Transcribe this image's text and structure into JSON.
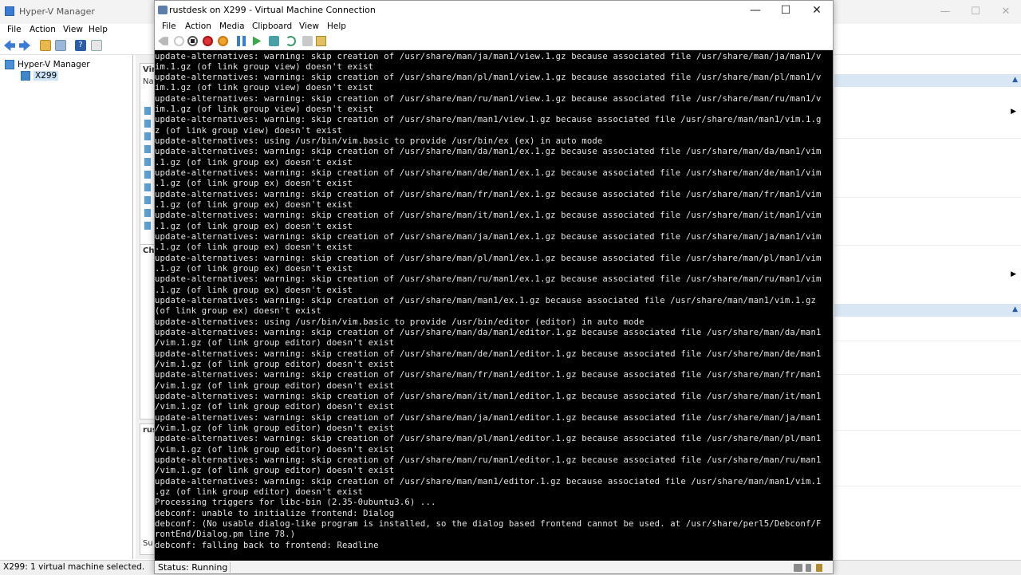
{
  "hyperv": {
    "title": "Hyper-V Manager",
    "menu": [
      "File",
      "Action",
      "View",
      "Help"
    ],
    "tree": {
      "root": "Hyper-V Manager",
      "host": "X299"
    },
    "panes": {
      "vm_header": "Vir",
      "vm_col": "Na",
      "checkpoints_header": "Ch",
      "details_header": "rus",
      "details_footer": "Su"
    },
    "status": "X299:  1 virtual machine selected."
  },
  "vmconnect": {
    "title": "rustdesk on X299 - Virtual Machine Connection",
    "menu": [
      "File",
      "Action",
      "Media",
      "Clipboard",
      "View",
      "Help"
    ],
    "status": "Status: Running",
    "terminal_lines": [
      "update-alternatives: warning: skip creation of /usr/share/man/ja/man1/view.1.gz because associated file /usr/share/man/ja/man1/v",
      "im.1.gz (of link group view) doesn't exist",
      "update-alternatives: warning: skip creation of /usr/share/man/pl/man1/view.1.gz because associated file /usr/share/man/pl/man1/v",
      "im.1.gz (of link group view) doesn't exist",
      "update-alternatives: warning: skip creation of /usr/share/man/ru/man1/view.1.gz because associated file /usr/share/man/ru/man1/v",
      "im.1.gz (of link group view) doesn't exist",
      "update-alternatives: warning: skip creation of /usr/share/man/man1/view.1.gz because associated file /usr/share/man/man1/vim.1.g",
      "z (of link group view) doesn't exist",
      "update-alternatives: using /usr/bin/vim.basic to provide /usr/bin/ex (ex) in auto mode",
      "update-alternatives: warning: skip creation of /usr/share/man/da/man1/ex.1.gz because associated file /usr/share/man/da/man1/vim",
      ".1.gz (of link group ex) doesn't exist",
      "update-alternatives: warning: skip creation of /usr/share/man/de/man1/ex.1.gz because associated file /usr/share/man/de/man1/vim",
      ".1.gz (of link group ex) doesn't exist",
      "update-alternatives: warning: skip creation of /usr/share/man/fr/man1/ex.1.gz because associated file /usr/share/man/fr/man1/vim",
      ".1.gz (of link group ex) doesn't exist",
      "update-alternatives: warning: skip creation of /usr/share/man/it/man1/ex.1.gz because associated file /usr/share/man/it/man1/vim",
      ".1.gz (of link group ex) doesn't exist",
      "update-alternatives: warning: skip creation of /usr/share/man/ja/man1/ex.1.gz because associated file /usr/share/man/ja/man1/vim",
      ".1.gz (of link group ex) doesn't exist",
      "update-alternatives: warning: skip creation of /usr/share/man/pl/man1/ex.1.gz because associated file /usr/share/man/pl/man1/vim",
      ".1.gz (of link group ex) doesn't exist",
      "update-alternatives: warning: skip creation of /usr/share/man/ru/man1/ex.1.gz because associated file /usr/share/man/ru/man1/vim",
      ".1.gz (of link group ex) doesn't exist",
      "update-alternatives: warning: skip creation of /usr/share/man/man1/ex.1.gz because associated file /usr/share/man/man1/vim.1.gz",
      "(of link group ex) doesn't exist",
      "update-alternatives: using /usr/bin/vim.basic to provide /usr/bin/editor (editor) in auto mode",
      "update-alternatives: warning: skip creation of /usr/share/man/da/man1/editor.1.gz because associated file /usr/share/man/da/man1",
      "/vim.1.gz (of link group editor) doesn't exist",
      "update-alternatives: warning: skip creation of /usr/share/man/de/man1/editor.1.gz because associated file /usr/share/man/de/man1",
      "/vim.1.gz (of link group editor) doesn't exist",
      "update-alternatives: warning: skip creation of /usr/share/man/fr/man1/editor.1.gz because associated file /usr/share/man/fr/man1",
      "/vim.1.gz (of link group editor) doesn't exist",
      "update-alternatives: warning: skip creation of /usr/share/man/it/man1/editor.1.gz because associated file /usr/share/man/it/man1",
      "/vim.1.gz (of link group editor) doesn't exist",
      "update-alternatives: warning: skip creation of /usr/share/man/ja/man1/editor.1.gz because associated file /usr/share/man/ja/man1",
      "/vim.1.gz (of link group editor) doesn't exist",
      "update-alternatives: warning: skip creation of /usr/share/man/pl/man1/editor.1.gz because associated file /usr/share/man/pl/man1",
      "/vim.1.gz (of link group editor) doesn't exist",
      "update-alternatives: warning: skip creation of /usr/share/man/ru/man1/editor.1.gz because associated file /usr/share/man/ru/man1",
      "/vim.1.gz (of link group editor) doesn't exist",
      "update-alternatives: warning: skip creation of /usr/share/man/man1/editor.1.gz because associated file /usr/share/man/man1/vim.1",
      ".gz (of link group editor) doesn't exist",
      "Processing triggers for libc-bin (2.35-0ubuntu3.6) ...",
      "debconf: unable to initialize frontend: Dialog",
      "debconf: (No usable dialog-like program is installed, so the dialog based frontend cannot be used. at /usr/share/perl5/Debconf/F",
      "rontEnd/Dialog.pm line 78.)",
      "debconf: falling back to frontend: Readline"
    ]
  },
  "icons": {
    "minimize": "—",
    "maximize": "☐",
    "close": "✕",
    "caret_up": "▲",
    "arrow_right": "▶"
  },
  "colors": {
    "terminal_bg": "#000000",
    "terminal_fg": "#e6e6e6",
    "selection": "#cce4f7",
    "action_header": "#d9e6f4"
  }
}
